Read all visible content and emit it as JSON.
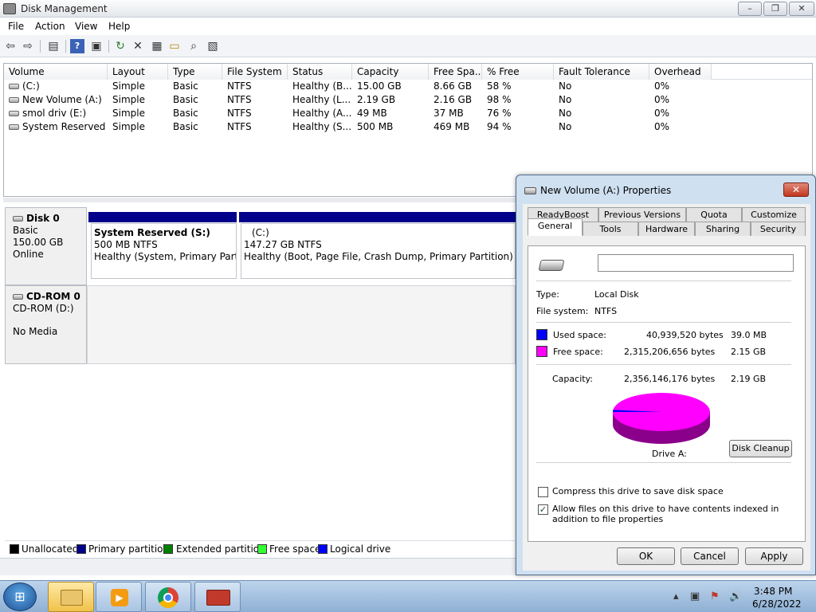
{
  "window": {
    "title": "Disk Management",
    "minimize": "–",
    "maximize": "❐",
    "close": "✕"
  },
  "menu": [
    "File",
    "Action",
    "View",
    "Help"
  ],
  "toolbar_icons": [
    "back-icon",
    "forward-icon",
    "properties-list-icon",
    "help-icon",
    "console-icon",
    "refresh-icon",
    "delete-icon",
    "properties-icon",
    "open-icon",
    "search-icon",
    "settings-icon"
  ],
  "table": {
    "headers": [
      "Volume",
      "Layout",
      "Type",
      "File System",
      "Status",
      "Capacity",
      "Free Spa...",
      "% Free",
      "Fault Tolerance",
      "Overhead"
    ],
    "rows": [
      [
        "(C:)",
        "Simple",
        "Basic",
        "NTFS",
        "Healthy (B...",
        "15.00 GB",
        "8.66 GB",
        "58 %",
        "No",
        "0%"
      ],
      [
        "New Volume (A:)",
        "Simple",
        "Basic",
        "NTFS",
        "Healthy (L...",
        "2.19 GB",
        "2.16 GB",
        "98 %",
        "No",
        "0%"
      ],
      [
        "smol driv (E:)",
        "Simple",
        "Basic",
        "NTFS",
        "Healthy (A...",
        "49 MB",
        "37 MB",
        "76 %",
        "No",
        "0%"
      ],
      [
        "System Reserved (...",
        "Simple",
        "Basic",
        "NTFS",
        "Healthy (S...",
        "500 MB",
        "469 MB",
        "94 %",
        "No",
        "0%"
      ]
    ]
  },
  "disks": {
    "disk0": {
      "name": "Disk 0",
      "type": "Basic",
      "size": "150.00 GB",
      "status": "Online",
      "p1": {
        "title": "System Reserved  (S:)",
        "size": "500 MB NTFS",
        "status": "Healthy (System, Primary Partitio"
      },
      "p2": {
        "title": "(C:)",
        "size": "147.27 GB NTFS",
        "status": "Healthy (Boot, Page File, Crash Dump, Primary Partition)"
      }
    },
    "cdrom0": {
      "name": "CD-ROM 0",
      "drive": "CD-ROM (D:)",
      "media": "No Media"
    }
  },
  "legend": [
    {
      "label": "Unallocated",
      "color": "#000000"
    },
    {
      "label": "Primary partition",
      "color": "#00008b"
    },
    {
      "label": "Extended partition",
      "color": "#008000"
    },
    {
      "label": "Free space",
      "color": "#33ff33"
    },
    {
      "label": "Logical drive",
      "color": "#0000ff"
    }
  ],
  "dialog": {
    "title": "New Volume (A:) Properties",
    "close": "✕",
    "tabs_row1": [
      "ReadyBoost",
      "Previous Versions",
      "Quota",
      "Customize"
    ],
    "tabs_row2": [
      "General",
      "Tools",
      "Hardware",
      "Sharing",
      "Security"
    ],
    "name_value": "",
    "type_label": "Type:",
    "type_value": "Local Disk",
    "fs_label": "File system:",
    "fs_value": "NTFS",
    "used_label": "Used space:",
    "used_bytes": "40,939,520 bytes",
    "used_size": "39.0 MB",
    "free_label": "Free space:",
    "free_bytes": "2,315,206,656 bytes",
    "free_size": "2.15 GB",
    "cap_label": "Capacity:",
    "cap_bytes": "2,356,146,176 bytes",
    "cap_size": "2.19 GB",
    "drive_label": "Drive A:",
    "cleanup": "Disk Cleanup",
    "compress_label": "Compress this drive to save disk space",
    "compress_checked": false,
    "index_label": "Allow files on this drive to have contents indexed in addition to file properties",
    "index_checked": true,
    "ok": "OK",
    "cancel": "Cancel",
    "apply": "Apply",
    "used_color": "#0000ff",
    "free_color": "#ff00ff",
    "used_fraction": 0.0174
  },
  "taskbar": {
    "time": "3:48 PM",
    "date": "6/28/2022",
    "apps": [
      "explorer-icon",
      "media-player-icon",
      "chrome-icon",
      "toolbox-icon"
    ]
  }
}
